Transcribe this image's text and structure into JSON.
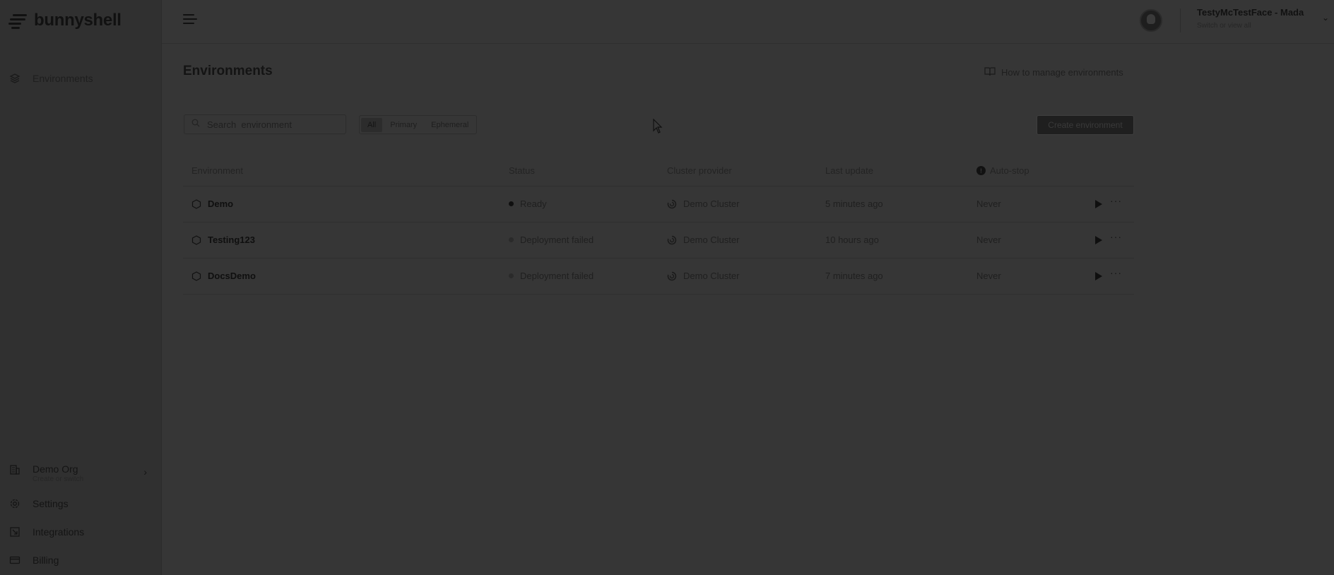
{
  "app": {
    "logo_text": "bunnyshell"
  },
  "sidebar": {
    "top_items": [
      {
        "label": "Environments",
        "icon": "layers-icon"
      }
    ],
    "org": {
      "name": "Demo Org",
      "sub": "Create or switch"
    },
    "bottom_items": [
      {
        "label": "Settings",
        "icon": "gear-icon"
      },
      {
        "label": "Integrations",
        "icon": "integrations-icon"
      },
      {
        "label": "Billing",
        "icon": "credit-card-icon"
      }
    ]
  },
  "topbar": {
    "user_name": "TestyMcTestFace - Mada",
    "user_sub": "Switch or view all"
  },
  "page": {
    "title": "Environments",
    "help_link": "How to manage environments",
    "search_placeholder": "Search  environment",
    "filters": [
      "All",
      "Primary",
      "Ephemeral"
    ],
    "active_filter": "All",
    "create_button": "Create environment"
  },
  "table": {
    "headers": {
      "environment": "Environment",
      "status": "Status",
      "cluster": "Cluster provider",
      "last_update": "Last update",
      "auto_stop": "Auto-stop"
    },
    "rows": [
      {
        "name": "Demo",
        "status": "Ready",
        "status_color": "#0f0f0f",
        "cluster": "Demo Cluster",
        "last_update": "5 minutes ago",
        "auto_stop": "Never"
      },
      {
        "name": "Testing123",
        "status": "Deployment failed",
        "status_color": "#2a2a2a",
        "cluster": "Demo Cluster",
        "last_update": "10 hours ago",
        "auto_stop": "Never"
      },
      {
        "name": "DocsDemo",
        "status": "Deployment failed",
        "status_color": "#2a2a2a",
        "cluster": "Demo Cluster",
        "last_update": "7 minutes ago",
        "auto_stop": "Never"
      }
    ]
  },
  "colors": {
    "background": "#363636",
    "sidebar": "#303030",
    "text": "#141414"
  }
}
